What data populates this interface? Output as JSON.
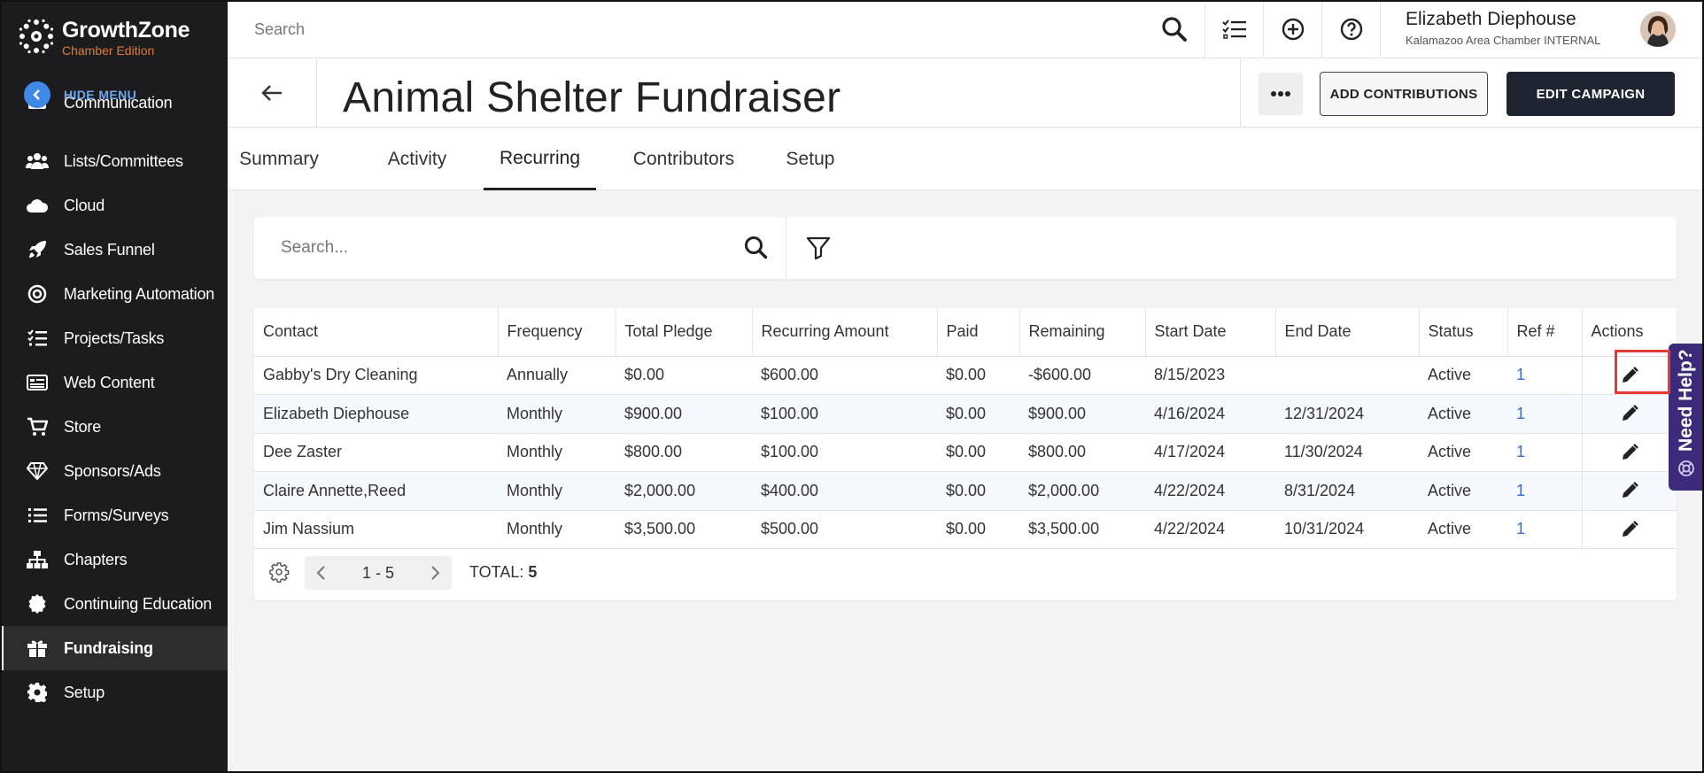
{
  "brand": {
    "name": "GrowthZone",
    "edition": "Chamber Edition",
    "edition_color": "#e07b39"
  },
  "sidebar": {
    "hide_menu_label": "HIDE MENU",
    "items": [
      {
        "label": "Communication",
        "icon": "envelope-icon"
      },
      {
        "label": "Lists/Committees",
        "icon": "users-icon"
      },
      {
        "label": "Cloud",
        "icon": "cloud-icon"
      },
      {
        "label": "Sales Funnel",
        "icon": "rocket-icon"
      },
      {
        "label": "Marketing Automation",
        "icon": "target-icon"
      },
      {
        "label": "Projects/Tasks",
        "icon": "tasks-icon"
      },
      {
        "label": "Web Content",
        "icon": "web-content-icon"
      },
      {
        "label": "Store",
        "icon": "cart-icon"
      },
      {
        "label": "Sponsors/Ads",
        "icon": "diamond-icon"
      },
      {
        "label": "Forms/Surveys",
        "icon": "list-icon"
      },
      {
        "label": "Chapters",
        "icon": "sitemap-icon"
      },
      {
        "label": "Continuing Education",
        "icon": "badge-icon"
      },
      {
        "label": "Fundraising",
        "icon": "gift-icon",
        "active": true
      },
      {
        "label": "Setup",
        "icon": "gear-icon"
      }
    ]
  },
  "topbar": {
    "search_placeholder": "Search",
    "user_name": "Elizabeth Diephouse",
    "user_org": "Kalamazoo Area Chamber INTERNAL"
  },
  "page": {
    "title": "Animal Shelter Fundraiser",
    "more_label": "•••",
    "add_contributions_label": "ADD CONTRIBUTIONS",
    "edit_campaign_label": "EDIT CAMPAIGN"
  },
  "tabs": [
    {
      "label": "Summary"
    },
    {
      "label": "Activity"
    },
    {
      "label": "Recurring",
      "active": true
    },
    {
      "label": "Contributors"
    },
    {
      "label": "Setup"
    }
  ],
  "table_search": {
    "placeholder": "Search..."
  },
  "table": {
    "columns": [
      "Contact",
      "Frequency",
      "Total Pledge",
      "Recurring Amount",
      "Paid",
      "Remaining",
      "Start Date",
      "End Date",
      "Status",
      "Ref #",
      "Actions"
    ],
    "rows": [
      [
        "Gabby's Dry Cleaning",
        "Annually",
        "$0.00",
        "$600.00",
        "$0.00",
        "-$600.00",
        "8/15/2023",
        "",
        "Active",
        "1"
      ],
      [
        "Elizabeth Diephouse",
        "Monthly",
        "$900.00",
        "$100.00",
        "$0.00",
        "$900.00",
        "4/16/2024",
        "12/31/2024",
        "Active",
        "1"
      ],
      [
        "Dee Zaster",
        "Monthly",
        "$800.00",
        "$100.00",
        "$0.00",
        "$800.00",
        "4/17/2024",
        "11/30/2024",
        "Active",
        "1"
      ],
      [
        "Claire Annette,Reed",
        "Monthly",
        "$2,000.00",
        "$400.00",
        "$0.00",
        "$2,000.00",
        "4/22/2024",
        "8/31/2024",
        "Active",
        "1"
      ],
      [
        "Jim Nassium",
        "Monthly",
        "$3,500.00",
        "$500.00",
        "$0.00",
        "$3,500.00",
        "4/22/2024",
        "10/31/2024",
        "Active",
        "1"
      ]
    ]
  },
  "pager": {
    "range": "1 - 5",
    "total_label": "TOTAL:",
    "total_value": "5"
  },
  "need_help": {
    "label": "Need Help?",
    "color": "#3c2a7a"
  },
  "colors": {
    "sidebar_bg": "#1c1c1e",
    "primary_button": "#1e2530",
    "link": "#2d6fd6",
    "highlight": "#e53935"
  }
}
